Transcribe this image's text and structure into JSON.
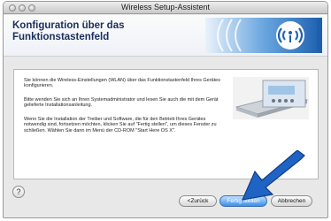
{
  "window": {
    "title": "Wireless Setup-Assistent"
  },
  "banner": {
    "heading_line1": "Konfiguration über das",
    "heading_line2": "Funktionstastenfeld"
  },
  "content": {
    "paragraph1": "Sie können die Wireless-Einstellungen (WLAN) über das Funktionstastenfeld Ihres Gerätes konfigurieren.",
    "paragraph2": "Bitte wenden Sie sich an Ihren Systemadministrator und lesen Sie auch die mit dem Gerät gelieferte Installationsanleitung.",
    "paragraph3": "Wenn Sie die Installation der Treiber und Software, die für den Betrieb Ihres Gerätes notwendig sind, fortsetzen möchten, klicken Sie auf \"Fertig stellen\", um dieses Fenster zu schließen. Wählen Sie dann im Menü der CD-ROM \"Start Here OS X\"."
  },
  "buttons": {
    "help": "?",
    "back": "<Zurück",
    "finish": "Fertig stellen",
    "cancel": "Abbrechen"
  },
  "icons": [
    "close-icon",
    "minimize-icon",
    "zoom-icon",
    "wireless-logo-icon",
    "device-panel-icon",
    "help-icon",
    "pointer-arrow-icon"
  ],
  "colors": {
    "heading": "#1b2f5c",
    "accent": "#3d8ee6",
    "arrow": "#1f63c4"
  }
}
